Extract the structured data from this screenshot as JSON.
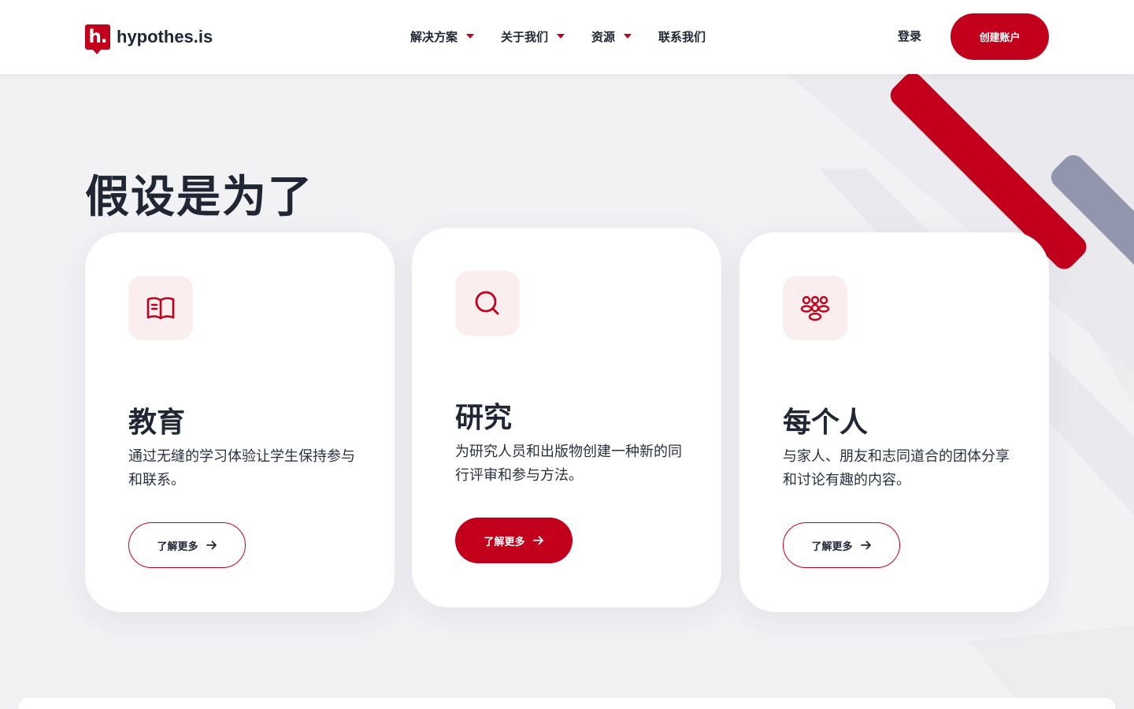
{
  "brand": {
    "mark": "h.",
    "name": "hypothes.is"
  },
  "nav": {
    "items": [
      {
        "label": "解决方案",
        "has_dropdown": true
      },
      {
        "label": "关于我们",
        "has_dropdown": true
      },
      {
        "label": "资源",
        "has_dropdown": true
      },
      {
        "label": "联系我们",
        "has_dropdown": false
      }
    ],
    "login": "登录",
    "signup": "创建账户"
  },
  "hero": {
    "title": "假设是为了"
  },
  "cards": [
    {
      "icon": "book-icon",
      "title": "教育",
      "description": "通过无缝的学习体验让学生保持参与和联系。",
      "button": "了解更多",
      "button_style": "outline"
    },
    {
      "icon": "search-icon",
      "title": "研究",
      "description": "为研究人员和出版物创建一种新的同行评审和参与方法。",
      "button": "了解更多",
      "button_style": "filled"
    },
    {
      "icon": "people-icon",
      "title": "每个人",
      "description": "与家人、朋友和志同道合的团体分享和讨论有趣的内容。",
      "button": "了解更多",
      "button_style": "outline"
    }
  ],
  "colors": {
    "accent": "#c2001c",
    "text": "#202634",
    "background": "#f2f2f5",
    "stripe_gray": "#9296ad",
    "icon_bg": "#fbeeee"
  }
}
